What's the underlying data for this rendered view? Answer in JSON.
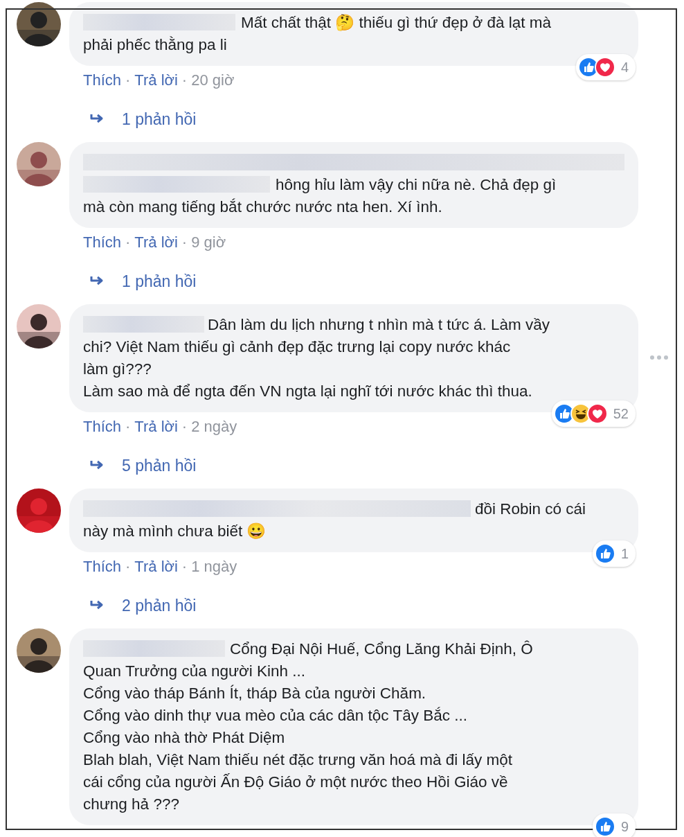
{
  "comments": [
    {
      "text": "Mất chất thật 🤔 thiếu gì thứ đẹp ở đà lạt mà\nphải phếc thằng pa li",
      "meta": [
        {
          "kind": "link",
          "text": "Thích"
        },
        {
          "kind": "dot",
          "text": "·"
        },
        {
          "kind": "link",
          "text": "Trả lời"
        },
        {
          "kind": "dot",
          "text": "·"
        },
        {
          "kind": "time",
          "text": "20 giờ"
        }
      ],
      "reactions": [
        {
          "kind": "like"
        },
        {
          "kind": "love"
        }
      ],
      "reaction_count": "4",
      "replies": "1 phản hồi",
      "more_options": false
    },
    {
      "text": "hông hỉu làm vậy chi nữa nè. Chả đẹp gì\nmà còn mang tiếng bắt chước nước nta hen. Xí ình.",
      "meta": [
        {
          "kind": "link",
          "text": "Thích"
        },
        {
          "kind": "dot",
          "text": "·"
        },
        {
          "kind": "link",
          "text": "Trả lời"
        },
        {
          "kind": "dot",
          "text": "·"
        },
        {
          "kind": "time",
          "text": "9 giờ"
        }
      ],
      "replies": "1 phản hồi",
      "more_options": false
    },
    {
      "text": "Dân làm du lịch nhưng t nhìn mà t tức á. Làm vầy\nchi? Việt Nam thiếu gì cảnh đẹp đặc trưng lại copy nước khác\nlàm gì???\nLàm sao mà để ngta đến VN ngta lại nghĩ tới nước khác thì thua.",
      "meta": [
        {
          "kind": "link",
          "text": "Thích"
        },
        {
          "kind": "dot",
          "text": "·"
        },
        {
          "kind": "link",
          "text": "Trả lời"
        },
        {
          "kind": "dot",
          "text": "·"
        },
        {
          "kind": "time",
          "text": "2 ngày"
        }
      ],
      "reactions": [
        {
          "kind": "like"
        },
        {
          "kind": "haha"
        },
        {
          "kind": "love"
        }
      ],
      "reaction_count": "52",
      "replies": "5 phản hồi",
      "more_options": true
    },
    {
      "text": "đồi Robin có cái\nnày mà mình chưa biết 😀",
      "meta": [
        {
          "kind": "link",
          "text": "Thích"
        },
        {
          "kind": "dot",
          "text": "·"
        },
        {
          "kind": "link",
          "text": "Trả lời"
        },
        {
          "kind": "dot",
          "text": "·"
        },
        {
          "kind": "time",
          "text": "1 ngày"
        }
      ],
      "reactions": [
        {
          "kind": "like"
        }
      ],
      "reaction_count": "1",
      "replies": "2 phản hồi",
      "more_options": false
    },
    {
      "text": "Cổng Đại Nội Huế, Cổng Lăng Khải Định, Ô\nQuan Trưởng của người Kinh ...\nCổng vào tháp Bánh Ít, tháp Bà của người Chăm.\nCổng vào dinh thự vua mèo của các dân tộc Tây Bắc ...\nCổng vào nhà thờ Phát Diệm\nBlah blah, Việt Nam thiếu nét đặc trưng văn hoá mà đi lấy một\ncái cổng của người Ấn Độ Giáo ở một nước theo Hồi Giáo về\nchưng hả ???",
      "reactions": [
        {
          "kind": "like"
        }
      ],
      "reaction_count": "9",
      "more_options": false
    }
  ]
}
